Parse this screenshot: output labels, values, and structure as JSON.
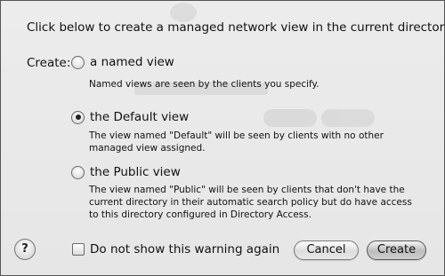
{
  "intro_text": "Click below to create a managed network view in the current directory.",
  "create_label": "Create:",
  "options": [
    {
      "label": "a named view",
      "checked": false,
      "description": [
        "Named views are seen by the clients you specify."
      ]
    },
    {
      "label": "the Default view",
      "checked": true,
      "description": [
        "The view named \"Default\" will be seen by clients with no other",
        "managed view assigned."
      ]
    },
    {
      "label": "the Public view",
      "checked": false,
      "description": [
        "The view named \"Public\" will be seen by clients that don't have the",
        "current directory in their automatic search policy but do have access",
        "to this directory configured in Directory Access."
      ]
    }
  ],
  "help_label": "?",
  "dont_show_label": "Do not show this warning again",
  "dont_show_checked": false,
  "buttons": {
    "cancel": "Cancel",
    "create": "Create"
  }
}
